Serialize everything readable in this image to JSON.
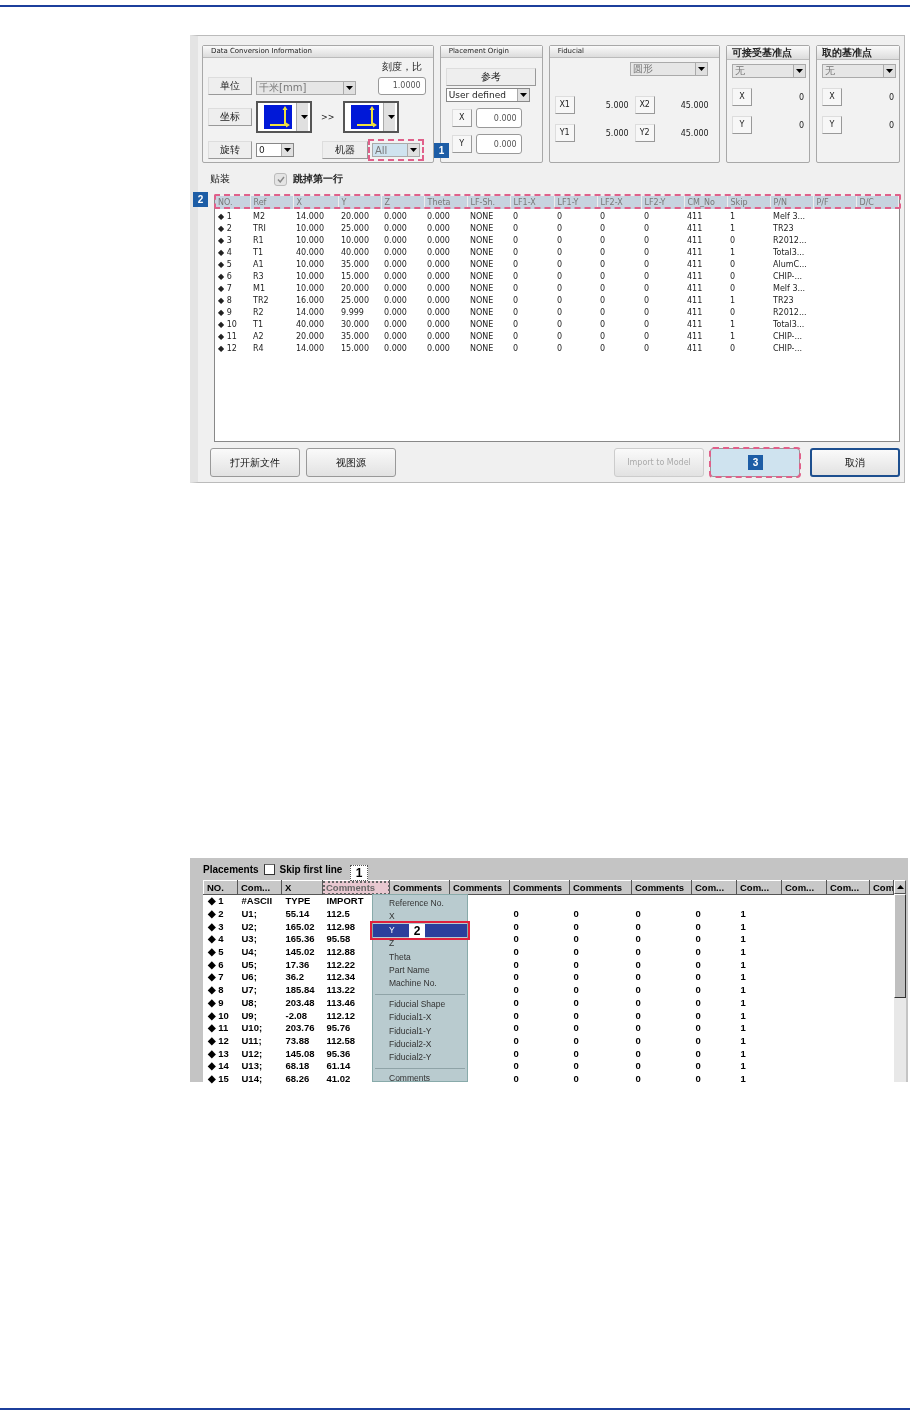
{
  "screenshot_1": {
    "data_conversion": {
      "title": "Data Conversion Information",
      "unit_label": "单位",
      "unit": {
        "value": "千米[mm]",
        "disabled": true
      },
      "scale_label": "刻度，比",
      "scale": "1.0000",
      "coordinate_label": "坐标",
      "coordinate_arrow": ">>",
      "rotation_label": "旋转",
      "rotation": "0",
      "machine_label": "机器",
      "machine": {
        "value": "All",
        "disabled": true,
        "callout": "1"
      }
    },
    "placement_origin": {
      "title": "Placement Origin",
      "reference_label": "参考",
      "reference": "User defined",
      "fields": [
        {
          "label": "X",
          "value": "0.000"
        },
        {
          "label": "Y",
          "value": "0.000"
        }
      ]
    },
    "fiducial": {
      "title": "Fiducial",
      "shape": {
        "value": "圆形",
        "disabled": true
      },
      "fields": [
        {
          "label": "X1",
          "value": "5.000"
        },
        {
          "label": "X2",
          "value": "45.000"
        },
        {
          "label": "Y1",
          "value": "5.000"
        },
        {
          "label": "Y2",
          "value": "45.000"
        }
      ]
    },
    "reference_points": [
      {
        "title": "可接受基准点",
        "select": {
          "value": "无",
          "disabled": true
        },
        "fields": [
          {
            "label": "X",
            "value": "0"
          },
          {
            "label": "Y",
            "value": "0"
          }
        ]
      },
      {
        "title": "取的基准点",
        "select": {
          "value": "无",
          "disabled": true
        },
        "fields": [
          {
            "label": "X",
            "value": "0"
          },
          {
            "label": "Y",
            "value": "0"
          }
        ]
      }
    ],
    "placements": {
      "label": "贴装",
      "skip_first_line": {
        "label": "跳掉第一行",
        "checked": true,
        "disabled": true
      }
    },
    "table": {
      "callout": "2",
      "columns": [
        "NO.",
        "Ref",
        "X",
        "Y",
        "Z",
        "Theta",
        "LF-Sh.",
        "LF1-X",
        "LF1-Y",
        "LF2-X",
        "LF2-Y",
        "CM_No",
        "Skip",
        "P/N",
        "P/F",
        "D/C"
      ],
      "rows": [
        [
          "◆ 1",
          "M2",
          "14.000",
          "20.000",
          "0.000",
          "0.000",
          "NONE",
          "0",
          "0",
          "0",
          "0",
          "411",
          "1",
          "Melf 3..."
        ],
        [
          "◆ 2",
          "TRI",
          "10.000",
          "25.000",
          "0.000",
          "0.000",
          "NONE",
          "0",
          "0",
          "0",
          "0",
          "411",
          "1",
          "TR23"
        ],
        [
          "◆ 3",
          "R1",
          "10.000",
          "10.000",
          "0.000",
          "0.000",
          "NONE",
          "0",
          "0",
          "0",
          "0",
          "411",
          "0",
          "R2012..."
        ],
        [
          "◆ 4",
          "T1",
          "40.000",
          "40.000",
          "0.000",
          "0.000",
          "NONE",
          "0",
          "0",
          "0",
          "0",
          "411",
          "1",
          "Total3..."
        ],
        [
          "◆ 5",
          "A1",
          "10.000",
          "35.000",
          "0.000",
          "0.000",
          "NONE",
          "0",
          "0",
          "0",
          "0",
          "411",
          "0",
          "AlumC..."
        ],
        [
          "◆ 6",
          "R3",
          "10.000",
          "15.000",
          "0.000",
          "0.000",
          "NONE",
          "0",
          "0",
          "0",
          "0",
          "411",
          "0",
          "CHIP-..."
        ],
        [
          "◆ 7",
          "M1",
          "10.000",
          "20.000",
          "0.000",
          "0.000",
          "NONE",
          "0",
          "0",
          "0",
          "0",
          "411",
          "0",
          "Melf 3..."
        ],
        [
          "◆ 8",
          "TR2",
          "16.000",
          "25.000",
          "0.000",
          "0.000",
          "NONE",
          "0",
          "0",
          "0",
          "0",
          "411",
          "1",
          "TR23"
        ],
        [
          "◆ 9",
          "R2",
          "14.000",
          "9.999",
          "0.000",
          "0.000",
          "NONE",
          "0",
          "0",
          "0",
          "0",
          "411",
          "0",
          "R2012..."
        ],
        [
          "◆ 10",
          "T1",
          "40.000",
          "30.000",
          "0.000",
          "0.000",
          "NONE",
          "0",
          "0",
          "0",
          "0",
          "411",
          "1",
          "Total3..."
        ],
        [
          "◆ 11",
          "A2",
          "20.000",
          "35.000",
          "0.000",
          "0.000",
          "NONE",
          "0",
          "0",
          "0",
          "0",
          "411",
          "1",
          "CHIP-..."
        ],
        [
          "◆ 12",
          "R4",
          "14.000",
          "15.000",
          "0.000",
          "0.000",
          "NONE",
          "0",
          "0",
          "0",
          "0",
          "411",
          "0",
          "CHIP-..."
        ]
      ]
    },
    "buttons": [
      {
        "label": "打开新文件",
        "disabled": false,
        "default": false
      },
      {
        "label": "视图源",
        "disabled": false,
        "default": false
      },
      {
        "label": "Import to Model",
        "disabled": true,
        "default": false
      },
      {
        "callout": "3",
        "disabled": false,
        "default": false
      },
      {
        "label": "取消",
        "disabled": false,
        "default": true
      }
    ]
  },
  "screenshot_2": {
    "placements_label": "Placements",
    "skip_first_line": {
      "label": "Skip first line",
      "checked": false
    },
    "table": {
      "columns": [
        {
          "label": "NO.",
          "selected": false
        },
        {
          "label": "Com...",
          "selected": false
        },
        {
          "label": "X",
          "selected": false
        },
        {
          "label": "Comments",
          "selected": true,
          "callout": "1"
        },
        {
          "label": "Comments",
          "selected": false
        },
        {
          "label": "Comments",
          "selected": false
        },
        {
          "label": "Comments",
          "selected": false
        },
        {
          "label": "Comments",
          "selected": false
        },
        {
          "label": "Comments",
          "selected": false
        },
        {
          "label": "Com...",
          "selected": false
        },
        {
          "label": "Com...",
          "selected": false
        },
        {
          "label": "Com...",
          "selected": false
        },
        {
          "label": "Com...",
          "selected": false
        },
        {
          "label": "Com",
          "selected": false
        }
      ],
      "rows": [
        [
          "◆ 1",
          "#ASCII",
          "TYPE",
          "IMPORT"
        ],
        [
          "◆ 2",
          "U1;",
          "55.14",
          "112.5",
          null,
          null,
          "0",
          "0",
          "0",
          "0",
          "1"
        ],
        [
          "◆ 3",
          "U2;",
          "165.02",
          "112.98",
          null,
          null,
          "0",
          "0",
          "0",
          "0",
          "1"
        ],
        [
          "◆ 4",
          "U3;",
          "165.36",
          "95.58",
          null,
          null,
          "0",
          "0",
          "0",
          "0",
          "1"
        ],
        [
          "◆ 5",
          "U4;",
          "145.02",
          "112.88",
          null,
          null,
          "0",
          "0",
          "0",
          "0",
          "1"
        ],
        [
          "◆ 6",
          "U5;",
          "17.36",
          "112.22",
          null,
          null,
          "0",
          "0",
          "0",
          "0",
          "1"
        ],
        [
          "◆ 7",
          "U6;",
          "36.2",
          "112.34",
          null,
          null,
          "0",
          "0",
          "0",
          "0",
          "1"
        ],
        [
          "◆ 8",
          "U7;",
          "185.84",
          "113.22",
          null,
          null,
          "0",
          "0",
          "0",
          "0",
          "1"
        ],
        [
          "◆ 9",
          "U8;",
          "203.48",
          "113.46",
          null,
          null,
          "0",
          "0",
          "0",
          "0",
          "1"
        ],
        [
          "◆ 10",
          "U9;",
          "-2.08",
          "112.12",
          null,
          null,
          "0",
          "0",
          "0",
          "0",
          "1"
        ],
        [
          "◆ 11",
          "U10;",
          "203.76",
          "95.76",
          null,
          null,
          "0",
          "0",
          "0",
          "0",
          "1"
        ],
        [
          "◆ 12",
          "U11;",
          "73.88",
          "112.58",
          null,
          null,
          "0",
          "0",
          "0",
          "0",
          "1"
        ],
        [
          "◆ 13",
          "U12;",
          "145.08",
          "95.36",
          null,
          null,
          "0",
          "0",
          "0",
          "0",
          "1"
        ],
        [
          "◆ 14",
          "U13;",
          "68.18",
          "61.14",
          null,
          null,
          "0",
          "0",
          "0",
          "0",
          "1"
        ],
        [
          "◆ 15",
          "U14;",
          "68.26",
          "41.02",
          null,
          null,
          "0",
          "0",
          "0",
          "0",
          "1"
        ]
      ]
    },
    "context_menu": {
      "items": [
        {
          "kind": "item",
          "label": "Reference No.",
          "selected": false
        },
        {
          "kind": "item",
          "label": "X",
          "selected": false
        },
        {
          "kind": "item",
          "label": "Y",
          "selected": true,
          "callout": "2"
        },
        {
          "kind": "item",
          "label": "Z",
          "selected": false
        },
        {
          "kind": "item",
          "label": "Theta",
          "selected": false
        },
        {
          "kind": "item",
          "label": "Part Name",
          "selected": false
        },
        {
          "kind": "item",
          "label": "Machine No.",
          "selected": false
        },
        {
          "kind": "separator"
        },
        {
          "kind": "item",
          "label": "Fiducial Shape",
          "selected": false
        },
        {
          "kind": "item",
          "label": "Fiducial1-X",
          "selected": false
        },
        {
          "kind": "item",
          "label": "Fiducial1-Y",
          "selected": false
        },
        {
          "kind": "item",
          "label": "Fiducial2-X",
          "selected": false
        },
        {
          "kind": "item",
          "label": "Fiducial2-Y",
          "selected": false
        },
        {
          "kind": "separator"
        },
        {
          "kind": "item",
          "label": "Comments",
          "selected": false
        }
      ]
    }
  }
}
